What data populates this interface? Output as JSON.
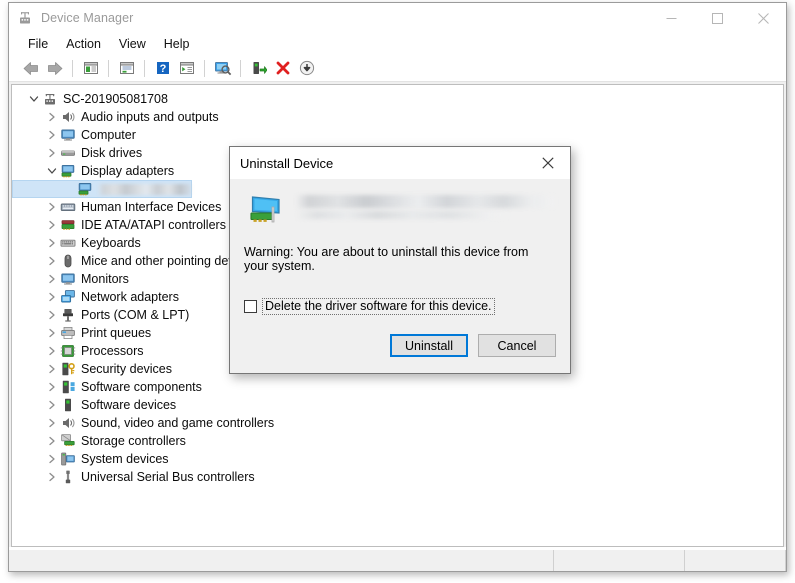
{
  "window": {
    "title": "Device Manager",
    "icon": "device-manager-icon",
    "controls": {
      "minimize": "minimize-icon",
      "maximize": "maximize-icon",
      "close": "close-icon"
    }
  },
  "menubar": {
    "items": [
      {
        "label": "File"
      },
      {
        "label": "Action"
      },
      {
        "label": "View"
      },
      {
        "label": "Help"
      }
    ]
  },
  "toolbar": {
    "buttons": [
      {
        "name": "back-icon",
        "title": "Back"
      },
      {
        "name": "forward-icon",
        "title": "Forward"
      },
      {
        "name": "separator-1",
        "title": ""
      },
      {
        "name": "show-hide-console-tree-icon",
        "title": "Show/Hide Console Tree"
      },
      {
        "name": "separator-2",
        "title": ""
      },
      {
        "name": "properties-icon",
        "title": "Properties"
      },
      {
        "name": "separator-3",
        "title": ""
      },
      {
        "name": "help-icon",
        "title": "Help"
      },
      {
        "name": "show-hide-action-pane-icon",
        "title": "Show/Hide Action Pane"
      },
      {
        "name": "separator-4",
        "title": ""
      },
      {
        "name": "scan-for-hardware-changes-icon",
        "title": "Scan for hardware changes"
      },
      {
        "name": "separator-5",
        "title": ""
      },
      {
        "name": "update-driver-icon",
        "title": "Update driver"
      },
      {
        "name": "uninstall-device-icon",
        "title": "Uninstall device"
      },
      {
        "name": "disable-device-icon",
        "title": "Disable device"
      }
    ]
  },
  "tree": {
    "root": {
      "label": "SC-201905081708",
      "icon": "computer-root-icon",
      "expanded": true
    },
    "nodes": [
      {
        "label": "Audio inputs and outputs",
        "icon": "speaker-icon",
        "expanded": false,
        "selected": false
      },
      {
        "label": "Computer",
        "icon": "monitor-icon",
        "expanded": false,
        "selected": false
      },
      {
        "label": "Disk drives",
        "icon": "disk-drive-icon",
        "expanded": false,
        "selected": false
      },
      {
        "label": "Display adapters",
        "icon": "display-adapter-icon",
        "expanded": true,
        "selected": false
      },
      {
        "label": "",
        "icon": "display-adapter-icon",
        "expanded": null,
        "selected": true,
        "redacted": true,
        "child": true
      },
      {
        "label": "Human Interface Devices",
        "icon": "hid-icon",
        "expanded": false,
        "selected": false
      },
      {
        "label": "IDE ATA/ATAPI controllers",
        "icon": "ide-controller-icon",
        "expanded": false,
        "selected": false
      },
      {
        "label": "Keyboards",
        "icon": "keyboard-icon",
        "expanded": false,
        "selected": false
      },
      {
        "label": "Mice and other pointing devices",
        "icon": "mouse-icon",
        "expanded": false,
        "selected": false
      },
      {
        "label": "Monitors",
        "icon": "monitor-icon",
        "expanded": false,
        "selected": false
      },
      {
        "label": "Network adapters",
        "icon": "network-adapter-icon",
        "expanded": false,
        "selected": false
      },
      {
        "label": "Ports (COM & LPT)",
        "icon": "port-icon",
        "expanded": false,
        "selected": false
      },
      {
        "label": "Print queues",
        "icon": "printer-icon",
        "expanded": false,
        "selected": false
      },
      {
        "label": "Processors",
        "icon": "processor-icon",
        "expanded": false,
        "selected": false
      },
      {
        "label": "Security devices",
        "icon": "security-device-icon",
        "expanded": false,
        "selected": false
      },
      {
        "label": "Software components",
        "icon": "software-component-icon",
        "expanded": false,
        "selected": false
      },
      {
        "label": "Software devices",
        "icon": "software-device-icon",
        "expanded": false,
        "selected": false
      },
      {
        "label": "Sound, video and game controllers",
        "icon": "speaker-icon",
        "expanded": false,
        "selected": false
      },
      {
        "label": "Storage controllers",
        "icon": "storage-controller-icon",
        "expanded": false,
        "selected": false
      },
      {
        "label": "System devices",
        "icon": "system-device-icon",
        "expanded": false,
        "selected": false
      },
      {
        "label": "Universal Serial Bus controllers",
        "icon": "usb-controller-icon",
        "expanded": false,
        "selected": false
      }
    ]
  },
  "statusbar": {
    "main": "",
    "section_a": "",
    "section_b": ""
  },
  "dialog": {
    "title": "Uninstall Device",
    "close_icon": "close-icon",
    "device_icon": "display-adapter-icon",
    "device_name": "",
    "device_name_redacted": true,
    "warning": "Warning: You are about to uninstall this device from your system.",
    "checkbox": {
      "label": "Delete the driver software for this device.",
      "checked": false,
      "focused": true
    },
    "buttons": [
      {
        "label": "Uninstall",
        "default": true
      },
      {
        "label": "Cancel",
        "default": false
      }
    ]
  },
  "colors": {
    "accent": "#0078d7",
    "selection": "#cfe4f7",
    "window_bg": "#ffffff",
    "chrome_bg": "#f0f0f0",
    "title_text": "#9a9a9a"
  }
}
